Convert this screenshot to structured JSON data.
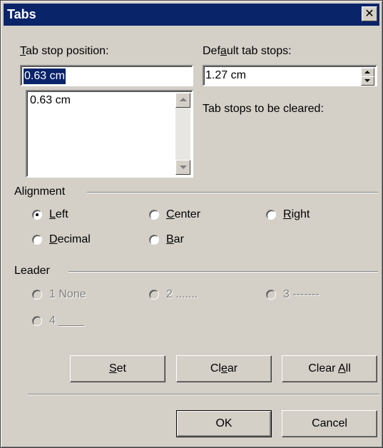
{
  "dialog": {
    "title": "Tabs",
    "close_glyph": "✕"
  },
  "tab_stop_position": {
    "label_mnemonic": "T",
    "label_rest": "ab stop position:",
    "value": "0.63 cm",
    "list_items": [
      "0.63 cm"
    ]
  },
  "default_tab_stops": {
    "label_pre": "Def",
    "label_mnemonic": "a",
    "label_rest": "ult tab stops:",
    "value": "1.27 cm"
  },
  "tab_stops_to_be_cleared": {
    "label": "Tab stops to be cleared:"
  },
  "alignment": {
    "label": "Alignment",
    "selected": "Left",
    "options": [
      {
        "mnemonic": "L",
        "rest": "eft"
      },
      {
        "mnemonic": "C",
        "rest": "enter"
      },
      {
        "mnemonic": "R",
        "rest": "ight"
      },
      {
        "mnemonic": "D",
        "rest": "ecimal"
      },
      {
        "mnemonic": "B",
        "rest": "ar"
      }
    ]
  },
  "leader": {
    "label": "Leader",
    "enabled": false,
    "options": [
      "1 None",
      "2 .......",
      "3 -------",
      "4 ____"
    ]
  },
  "buttons": {
    "set_mnemonic": "S",
    "set_rest": "et",
    "clear_pre": "Cl",
    "clear_mnemonic": "e",
    "clear_rest": "ar",
    "clear_all_pre": "Clear ",
    "clear_all_mnemonic": "A",
    "clear_all_rest": "ll",
    "ok": "OK",
    "cancel": "Cancel"
  },
  "colors": {
    "title_bar": "#0a246a",
    "face": "#d4d0c8",
    "selection": "#0a246a"
  }
}
